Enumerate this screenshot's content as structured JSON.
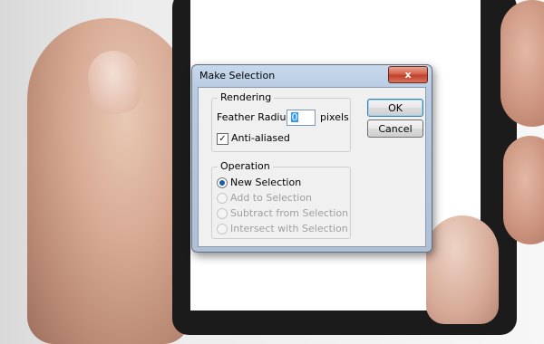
{
  "dialog": {
    "title": "Make Selection",
    "close_glyph": "x",
    "rendering": {
      "label": "Rendering",
      "feather_label": "Feather Radius:",
      "feather_value": "0",
      "feather_unit": "pixels",
      "anti_aliased_label": "Anti-aliased",
      "anti_aliased_checked": true
    },
    "operation": {
      "label": "Operation",
      "options": [
        {
          "label": "New Selection",
          "selected": true,
          "enabled": true
        },
        {
          "label": "Add to Selection",
          "selected": false,
          "enabled": false
        },
        {
          "label": "Subtract from Selection",
          "selected": false,
          "enabled": false
        },
        {
          "label": "Intersect with Selection",
          "selected": false,
          "enabled": false
        }
      ]
    },
    "buttons": {
      "ok": "OK",
      "cancel": "Cancel"
    }
  }
}
